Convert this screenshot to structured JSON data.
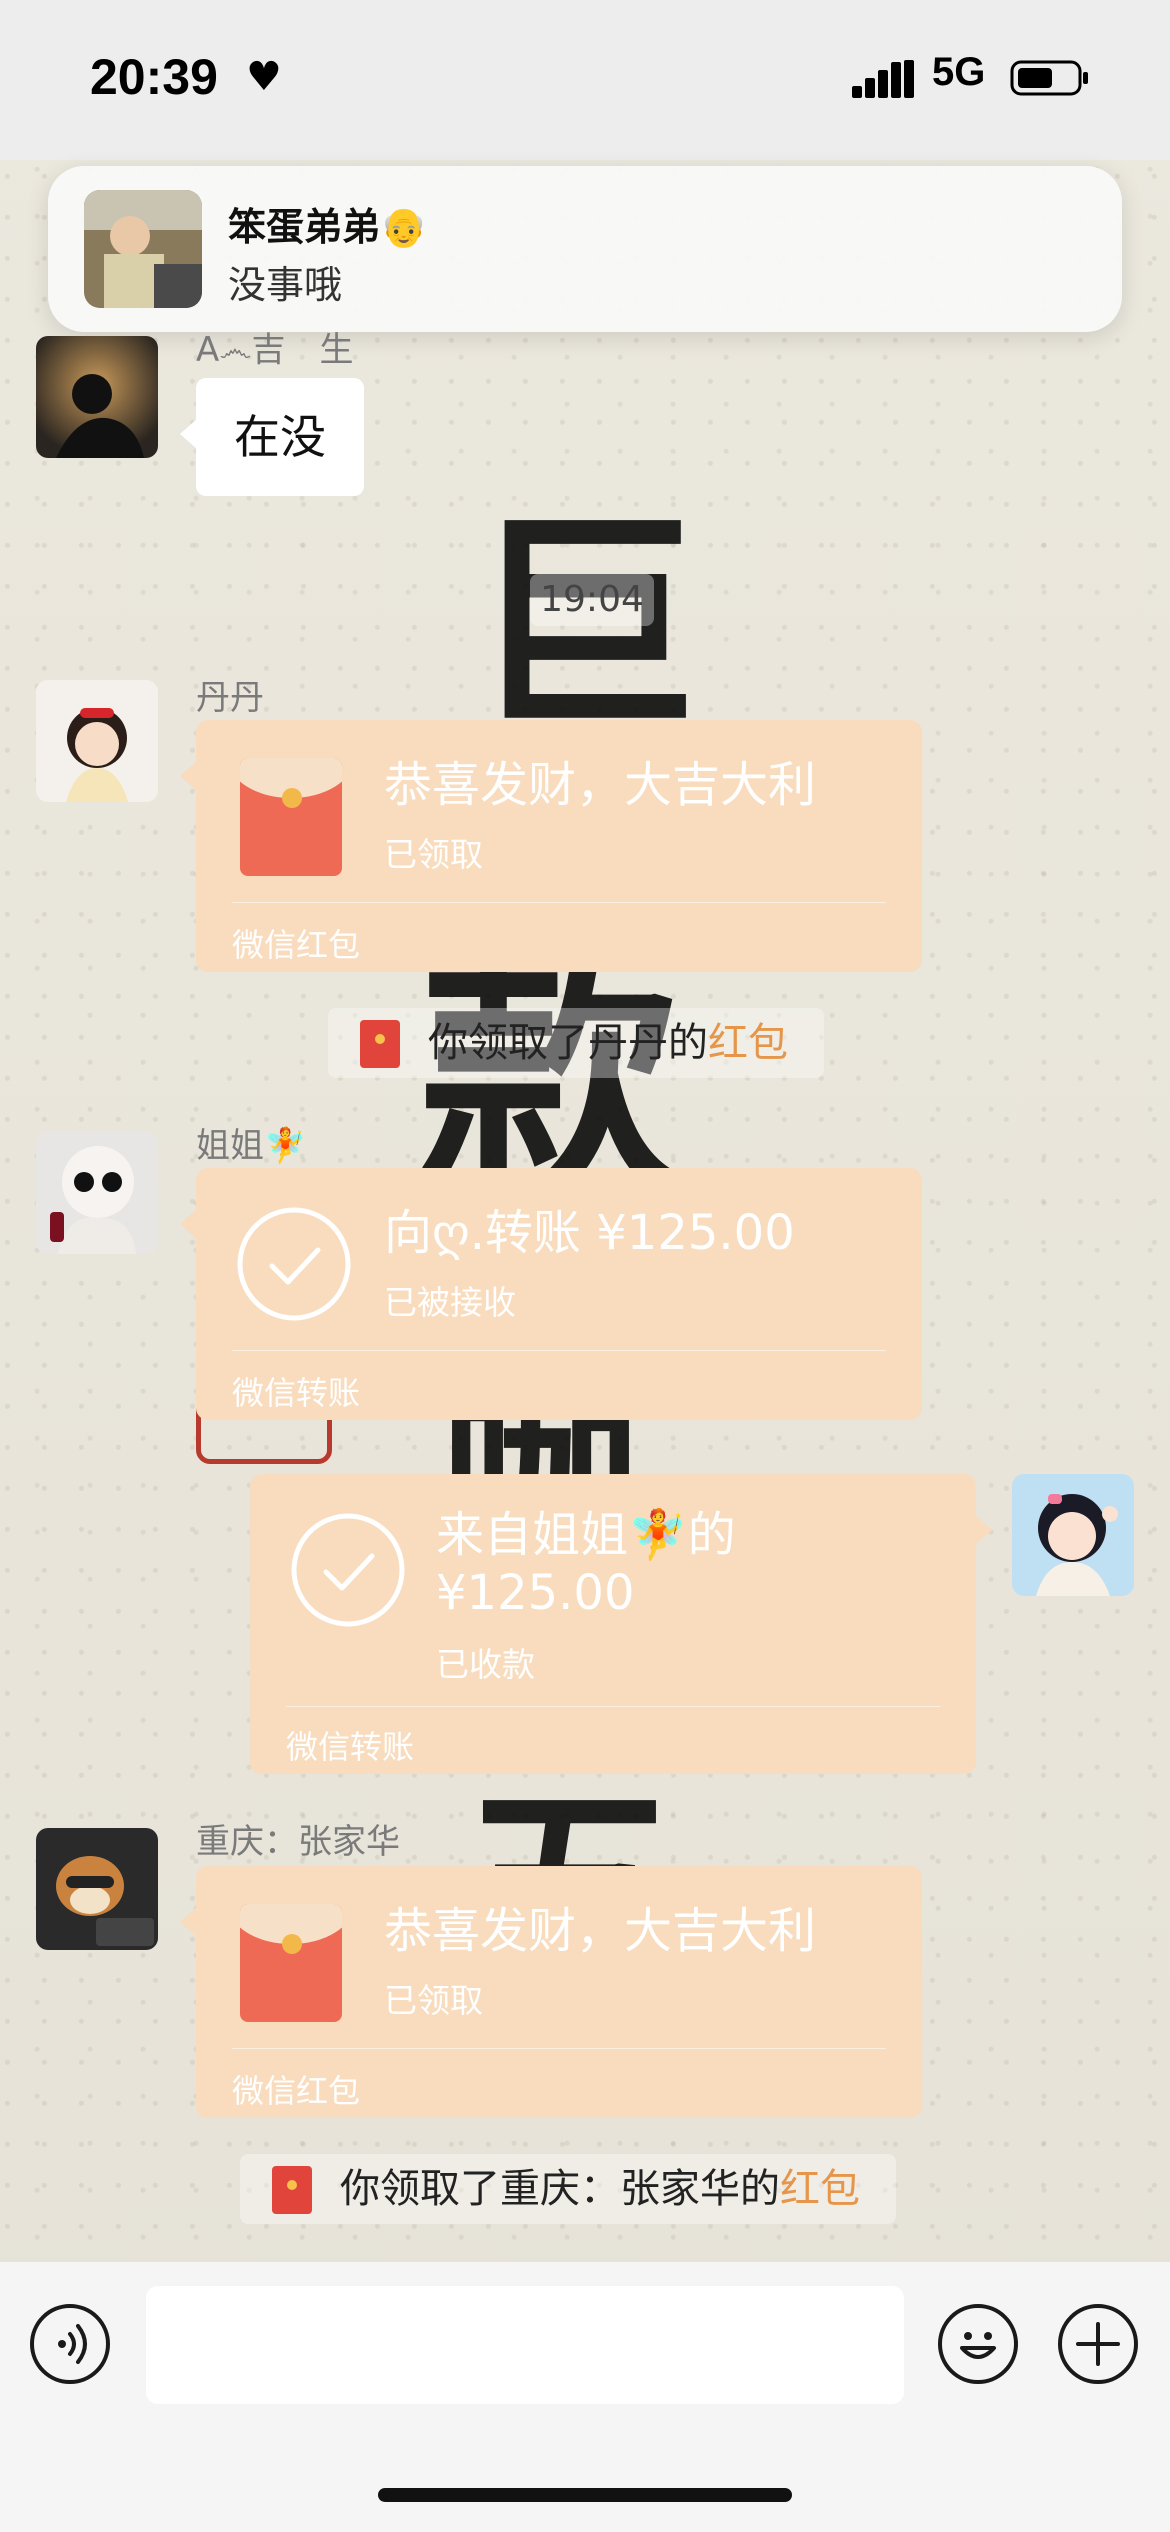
{
  "status_bar": {
    "time": "20:39",
    "network": "5G"
  },
  "notification": {
    "name": "笨蛋弟弟👴",
    "message": "没事哦"
  },
  "background_calligraphy": [
    "巨",
    "款",
    "咖",
    "五"
  ],
  "messages": {
    "m1": {
      "sender": "A෴吉　生",
      "text": "在没"
    },
    "timestamp": "19:04",
    "m2": {
      "sender": "丹丹",
      "title": "恭喜发财，大吉大利",
      "status": "已领取",
      "footer": "微信红包"
    },
    "note1": {
      "prefix": "你领取了丹丹的",
      "highlight": "红包"
    },
    "m3": {
      "sender": "姐姐🧚",
      "title": "向ღ.转账 ¥125.00",
      "status": "已被接收",
      "footer": "微信转账"
    },
    "m4": {
      "title_line1": "来自姐姐🧚的",
      "title_line2": "¥125.00",
      "status": "已收款",
      "footer": "微信转账"
    },
    "m5": {
      "sender": "重庆：张家华",
      "title": "恭喜发财，大吉大利",
      "status": "已领取",
      "footer": "微信红包"
    },
    "note2": {
      "prefix": "你领取了重庆：张家华的",
      "highlight": "红包"
    }
  },
  "colors": {
    "card": "#f8dcbd",
    "highlight": "#e5964b",
    "envelope": "#ee6a55"
  },
  "icons": {
    "voice": "voice-input-icon",
    "emoji": "emoji-icon",
    "plus": "plus-icon"
  }
}
